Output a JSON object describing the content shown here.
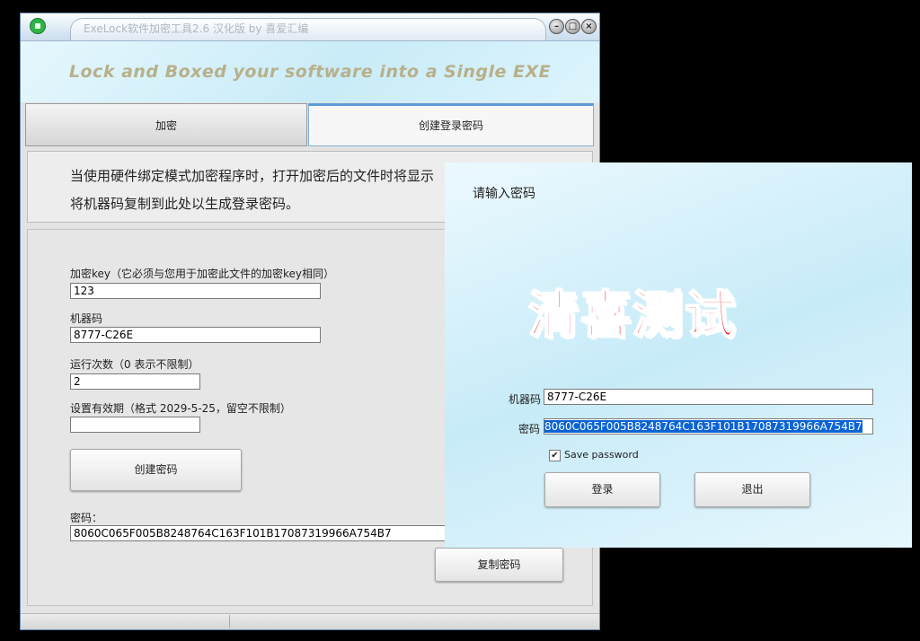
{
  "window": {
    "title": "ExeLock软件加密工具2.6 汉化版 by 喜爱汇编",
    "buttons": {
      "minimize": "–",
      "maximize": "□",
      "close": "×"
    }
  },
  "banner": {
    "text": "Lock and Boxed your software into a Single EXE"
  },
  "tabs": [
    {
      "label": "加密",
      "selected": false
    },
    {
      "label": "创建登录密码",
      "selected": true
    }
  ],
  "description": {
    "line1": "当使用硬件绑定模式加密程序时，打开加密后的文件时将显示",
    "line2": "将机器码复制到此处以生成登录密码。"
  },
  "form": {
    "key_label": "加密key（它必须与您用于加密此文件的加密key相同）",
    "key_value": "123",
    "machine_code_label": "机器码",
    "machine_code_value": "8777-C26E",
    "run_count_label": "运行次数（0 表示不限制）",
    "run_count_value": "2",
    "expiry_label": "设置有效期（格式 2029-5-25，留空不限制）",
    "expiry_value": "",
    "create_button": "创建密码",
    "password_label": "密码：",
    "password_value": "8060C065F005B8248764C163F101B17087319966A754B7",
    "copy_button": "复制密码"
  },
  "login_dialog": {
    "prompt": "请输入密码",
    "watermark": "清喜测试",
    "machine_code_label": "机器码",
    "machine_code_value": "8777-C26E",
    "password_label": "密码",
    "password_value": "8060C065F005B8248764C163F101B17087319966A754B7",
    "save_password_label": "Save password",
    "save_password_checked": true,
    "check_mark": "✔",
    "login_button": "登录",
    "exit_button": "退出"
  },
  "colors": {
    "banner_text": "#b8b08a",
    "selected_tab_accent": "#5c9bd6",
    "watermark": "#ee1c25",
    "selection_highlight": "#0a64d6"
  }
}
